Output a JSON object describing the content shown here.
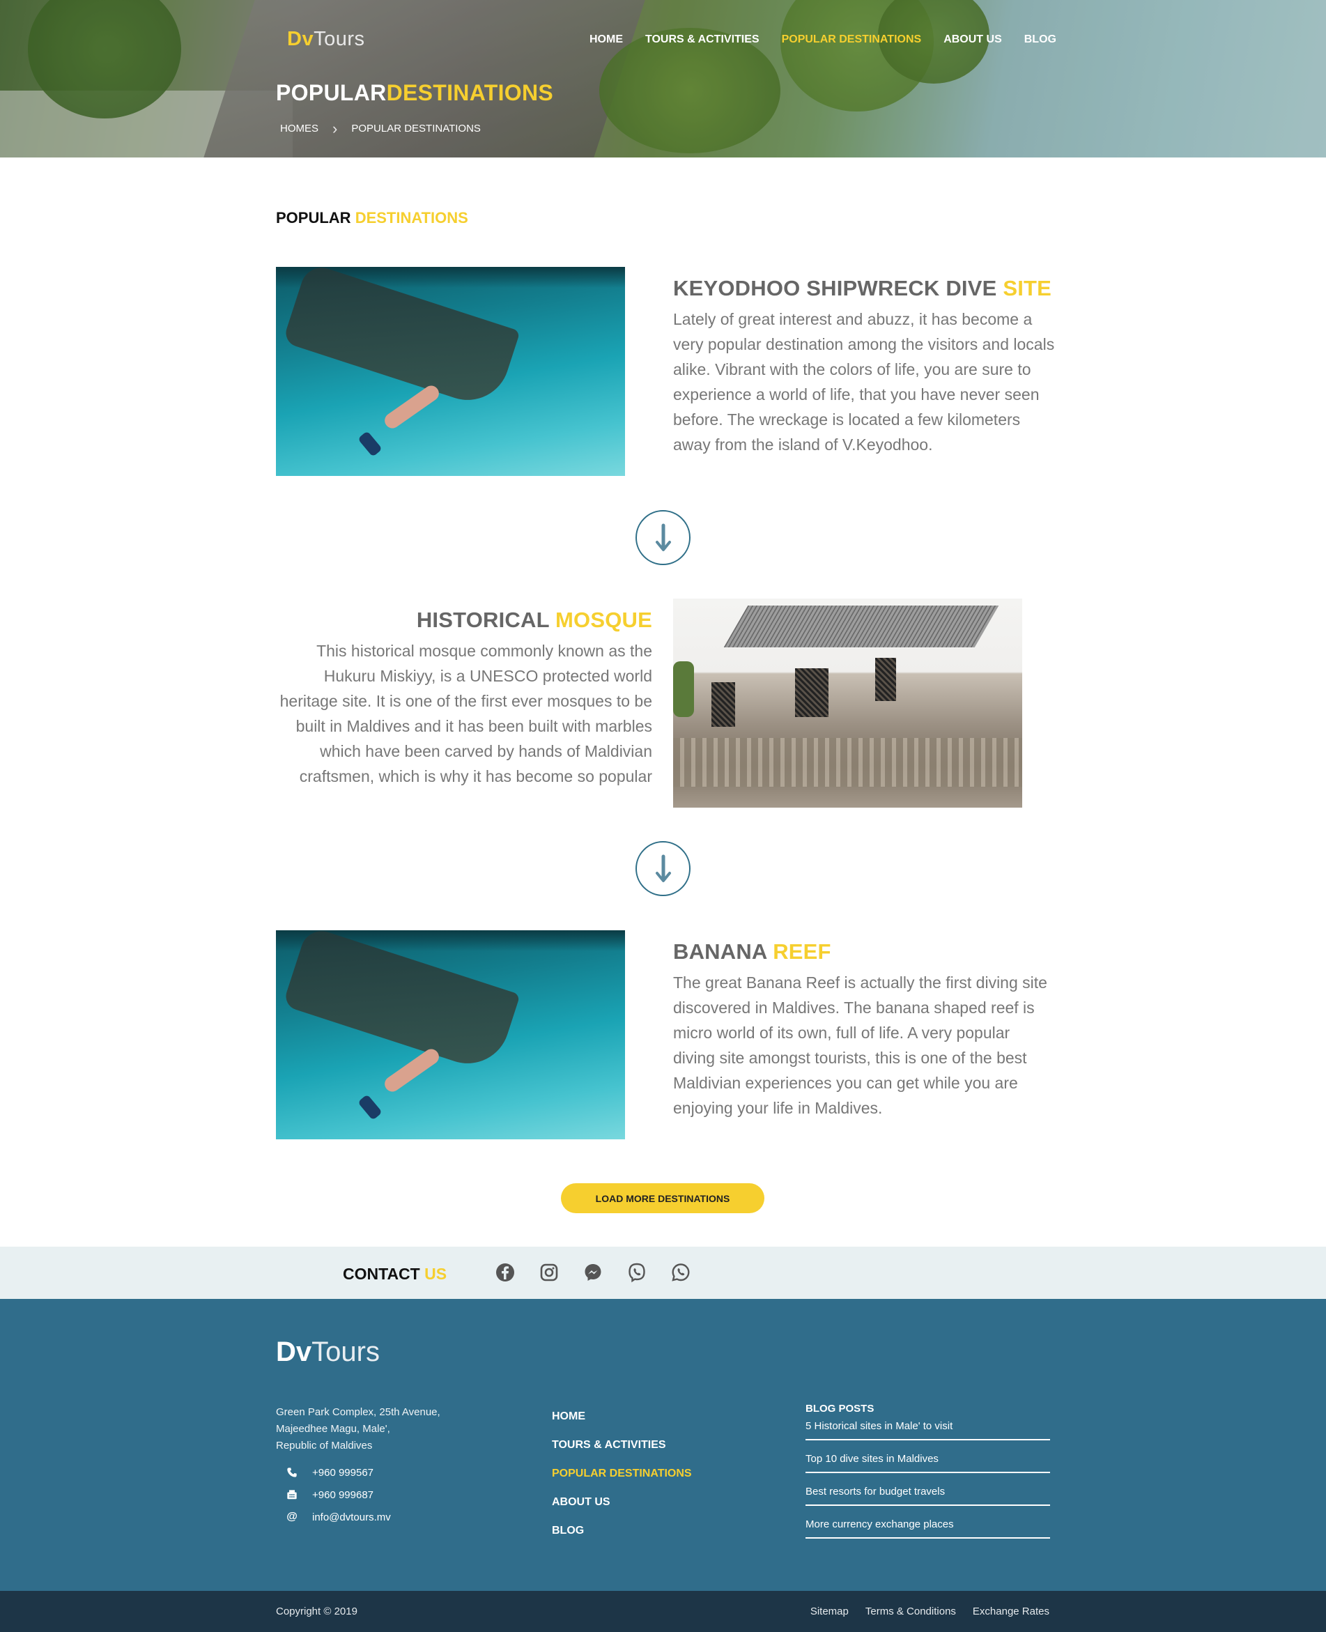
{
  "brand": {
    "first": "Dv",
    "second": "Tours"
  },
  "nav": {
    "items": [
      "HOME",
      "TOURS & ACTIVITIES",
      "POPULAR DESTINATIONS",
      "ABOUT US",
      "BLOG"
    ],
    "active_index": 2
  },
  "hero": {
    "title_part1": "POPULAR",
    "title_part2": "DESTINATIONS",
    "breadcrumb": [
      "HOMES",
      "POPULAR DESTINATIONS"
    ]
  },
  "section": {
    "title_part1": "POPULAR",
    "title_part2": "DESTINATIONS"
  },
  "destinations": [
    {
      "title_part1": "KEYODHOO SHIPWRECK DIVE",
      "title_part2": "SITE",
      "description": "Lately of great interest and abuzz, it has become a very popular destination among the visitors and locals alike. Vibrant with the colors of life, you are sure to experience a world of life, that you have never seen before. The wreckage is located a few kilometers away from the island of V.Keyodhoo."
    },
    {
      "title_part1": "HISTORICAL",
      "title_part2": "MOSQUE",
      "description": "This historical mosque commonly known as the Hukuru Miskiyy, is a UNESCO protected world heritage site. It is one of the first ever mosques to be built in Maldives and it has been built with marbles which have been carved by hands of Maldivian craftsmen, which is why it has become so popular"
    },
    {
      "title_part1": "BANANA",
      "title_part2": "REEF",
      "description": "The great Banana Reef is actually the first diving site discovered in Maldives. The banana shaped reef is micro world of its own, full of life. A very popular diving site amongst tourists, this is one of the best Maldivian experiences you can get while you are enjoying your life in Maldives."
    }
  ],
  "load_more": "LOAD MORE DESTINATIONS",
  "contact": {
    "title_part1": "CONTACT",
    "title_part2": "US",
    "socials": [
      "facebook-icon",
      "instagram-icon",
      "messenger-icon",
      "viber-icon",
      "whatsapp-icon"
    ]
  },
  "footer": {
    "address": [
      "Green Park Complex, 25th Avenue,",
      "Majeedhee Magu, Male',",
      "Republic of Maldives"
    ],
    "phone": "+960 999567",
    "fax": "+960 999687",
    "email": "info@dvtours.mv",
    "nav": [
      "HOME",
      "TOURS & ACTIVITIES",
      "POPULAR DESTINATIONS",
      "ABOUT US",
      "BLOG"
    ],
    "blog_heading": "BLOG POSTS",
    "blog_posts": [
      "5 Historical sites in Male' to visit",
      "Top 10 dive sites in Maldives",
      "Best resorts for budget travels",
      "More currency exchange places"
    ]
  },
  "bottom": {
    "copyright": "Copyright © 2019",
    "links": [
      "Sitemap",
      "Terms & Conditions",
      "Exchange Rates"
    ]
  },
  "colors": {
    "accent": "#f6cf2f",
    "footer_bg": "#306d8b",
    "bottom_bg": "#1d3547",
    "contact_bg": "#e8f0f2",
    "arrow": "#2f6f88"
  }
}
